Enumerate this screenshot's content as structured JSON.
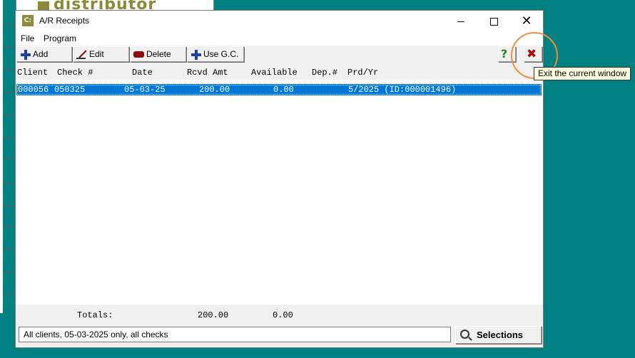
{
  "background_app": {
    "logo_text": "distributor"
  },
  "window": {
    "icon_text": "C:",
    "title": "A/R Receipts",
    "controls": {
      "close": "✕"
    }
  },
  "menu": [
    "File",
    "Program"
  ],
  "toolbar": {
    "add": "Add",
    "edit": "Edit",
    "delete": "Delete",
    "use_gc": "Use G.C.",
    "help": "?",
    "exit": "✖"
  },
  "columns": [
    "Client",
    "Check #",
    "Date",
    "Rcvd Amt",
    "Available",
    "Dep.#",
    "Prd/Yr"
  ],
  "rows": [
    {
      "client": "000056",
      "check": "050325",
      "date": "05-03-25",
      "rcvd_amt": "200.00",
      "available": "0.00",
      "dep": "",
      "prd_yr": "5/2025 (ID:000001496)"
    }
  ],
  "totals": {
    "label": "Totals:",
    "rcvd_amt": "200.00",
    "available": "0.00"
  },
  "status_text": "All clients, 05-03-2025 only, all checks",
  "selections_button": "Selections",
  "tooltip": "Exit the current window",
  "colors": {
    "desktop": "#008080",
    "selection": "#0078d7",
    "highlight_ring": "#f0903a",
    "tooltip_bg": "#ffffe1"
  }
}
